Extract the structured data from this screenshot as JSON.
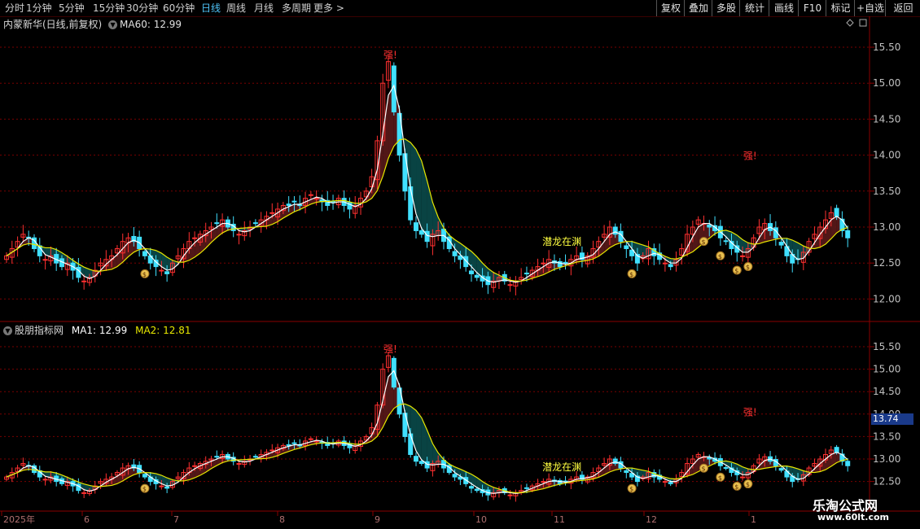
{
  "toolbar": {
    "periods": [
      "分时",
      "1分钟",
      "5分钟",
      "15分钟",
      "30分钟",
      "60分钟",
      "日线",
      "周线",
      "月线",
      "多周期",
      "更多 >"
    ],
    "active_period": "日线",
    "right_buttons": [
      "复权",
      "叠加",
      "多股",
      "统计",
      "画线",
      "F10",
      "标记",
      "+自选",
      "返回"
    ]
  },
  "top_pane": {
    "title": "内蒙新华(日线,前复权)",
    "indicator": "MA60: 12.99",
    "axis": [
      "15.50",
      "15.00",
      "14.50",
      "14.00",
      "13.50",
      "13.00",
      "12.50",
      "12.00"
    ],
    "signal_label": "潜龙在渊",
    "strong_label": "强!"
  },
  "bottom_pane": {
    "title": "股朋指标网",
    "ma1": "MA1: 12.99",
    "ma2": "MA2: 12.81",
    "axis": [
      "15.50",
      "15.00",
      "14.50",
      "14.00",
      "13.50",
      "13.00",
      "12.50"
    ],
    "price_tag": "13.74",
    "signal_label": "潜龙在渊",
    "strong_label": "强!"
  },
  "date_axis": [
    "2025年",
    "6",
    "7",
    "8",
    "9",
    "10",
    "11",
    "12",
    "1"
  ],
  "watermark": {
    "name": "乐淘公式网",
    "url": "www.60lt.com"
  },
  "colors": {
    "up": "#ff3030",
    "down": "#40e0ff",
    "ma_fast": "#ffffff",
    "ma_slow": "#e8e800",
    "fill_up": "#5a1a1a",
    "fill_down": "#0a4a4a",
    "grid": "#7a0000"
  },
  "chart_data": {
    "type": "candlestick",
    "y_range": [
      11.8,
      15.7
    ],
    "closes": [
      12.6,
      12.7,
      12.8,
      12.9,
      12.85,
      12.7,
      12.6,
      12.55,
      12.6,
      12.5,
      12.45,
      12.5,
      12.4,
      12.3,
      12.25,
      12.3,
      12.4,
      12.5,
      12.55,
      12.6,
      12.7,
      12.8,
      12.85,
      12.8,
      12.7,
      12.6,
      12.5,
      12.45,
      12.4,
      12.35,
      12.5,
      12.6,
      12.7,
      12.8,
      12.85,
      12.9,
      12.95,
      13.0,
      13.05,
      13.1,
      13.0,
      12.95,
      12.9,
      12.95,
      13.0,
      13.05,
      13.1,
      13.15,
      13.2,
      13.25,
      13.3,
      13.3,
      13.35,
      13.3,
      13.4,
      13.45,
      13.4,
      13.35,
      13.3,
      13.35,
      13.4,
      13.3,
      13.25,
      13.3,
      13.4,
      13.5,
      13.7,
      14.2,
      15.0,
      15.3,
      14.6,
      14.0,
      13.5,
      13.1,
      12.95,
      12.9,
      12.8,
      12.9,
      12.95,
      12.8,
      12.7,
      12.6,
      12.55,
      12.45,
      12.35,
      12.3,
      12.25,
      12.2,
      12.25,
      12.3,
      12.25,
      12.2,
      12.25,
      12.3,
      12.35,
      12.4,
      12.45,
      12.5,
      12.55,
      12.5,
      12.45,
      12.5,
      12.55,
      12.6,
      12.55,
      12.6,
      12.7,
      12.8,
      12.9,
      13.0,
      12.9,
      12.8,
      12.7,
      12.6,
      12.5,
      12.6,
      12.7,
      12.6,
      12.55,
      12.5,
      12.45,
      12.55,
      12.7,
      12.9,
      13.0,
      13.1,
      13.05,
      13.0,
      12.95,
      12.85,
      12.8,
      12.7,
      12.65,
      12.6,
      12.7,
      12.85,
      13.0,
      13.05,
      12.95,
      12.85,
      12.75,
      12.6,
      12.5,
      12.55,
      12.65,
      12.8,
      12.9,
      13.0,
      13.1,
      13.2,
      13.15,
      12.95,
      12.85
    ]
  }
}
